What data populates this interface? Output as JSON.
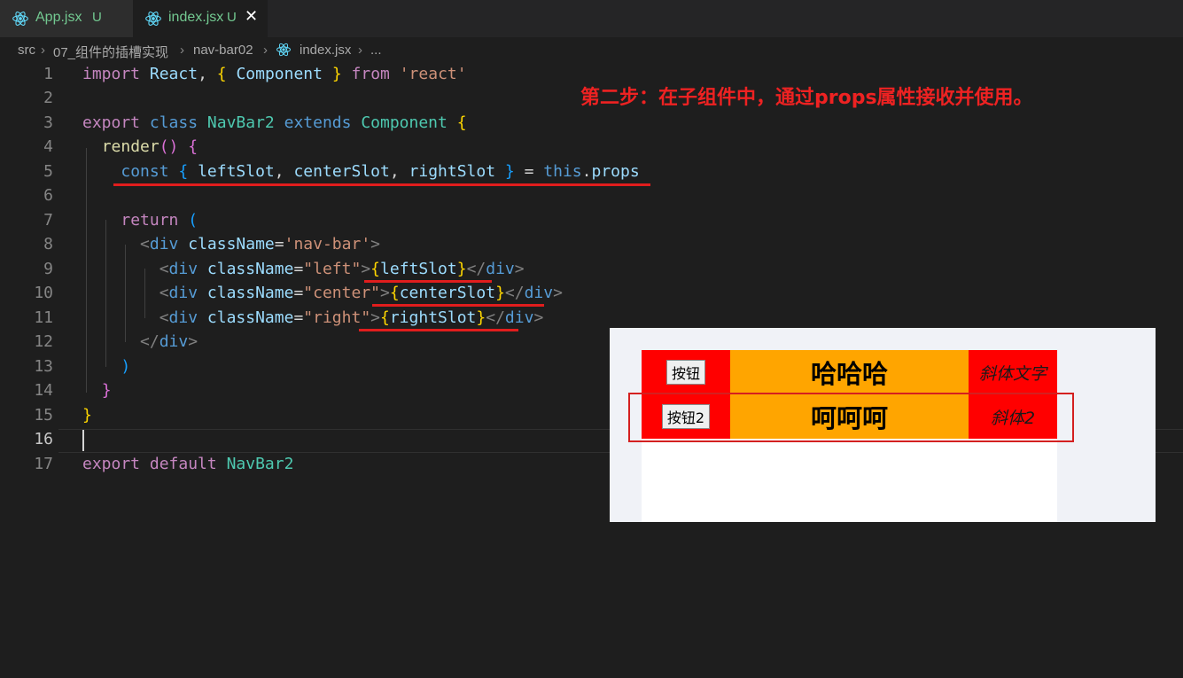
{
  "tabs": [
    {
      "label": "App.jsx",
      "status": "U"
    },
    {
      "label": "index.jsx",
      "status": "U"
    }
  ],
  "breadcrumb": {
    "items": [
      "src",
      "07_组件的插槽实现",
      "nav-bar02",
      "index.jsx",
      "..."
    ]
  },
  "editor": {
    "line_numbers": [
      "1",
      "2",
      "3",
      "4",
      "5",
      "6",
      "7",
      "8",
      "9",
      "10",
      "11",
      "12",
      "13",
      "14",
      "15",
      "16",
      "17"
    ],
    "active_line": "16"
  },
  "annotation": {
    "text": "第二步：在子组件中，通过props属性接收并使用。"
  },
  "preview": {
    "rows": [
      {
        "button": "按钮",
        "center": "哈哈哈",
        "right": "斜体文字"
      },
      {
        "button": "按钮2",
        "center": "呵呵呵",
        "right": "斜体2"
      }
    ]
  },
  "colors": {
    "annotation": "#ee2222",
    "nav_side": "#ff0000",
    "nav_center": "#ffa500",
    "untracked": "#73c991"
  }
}
